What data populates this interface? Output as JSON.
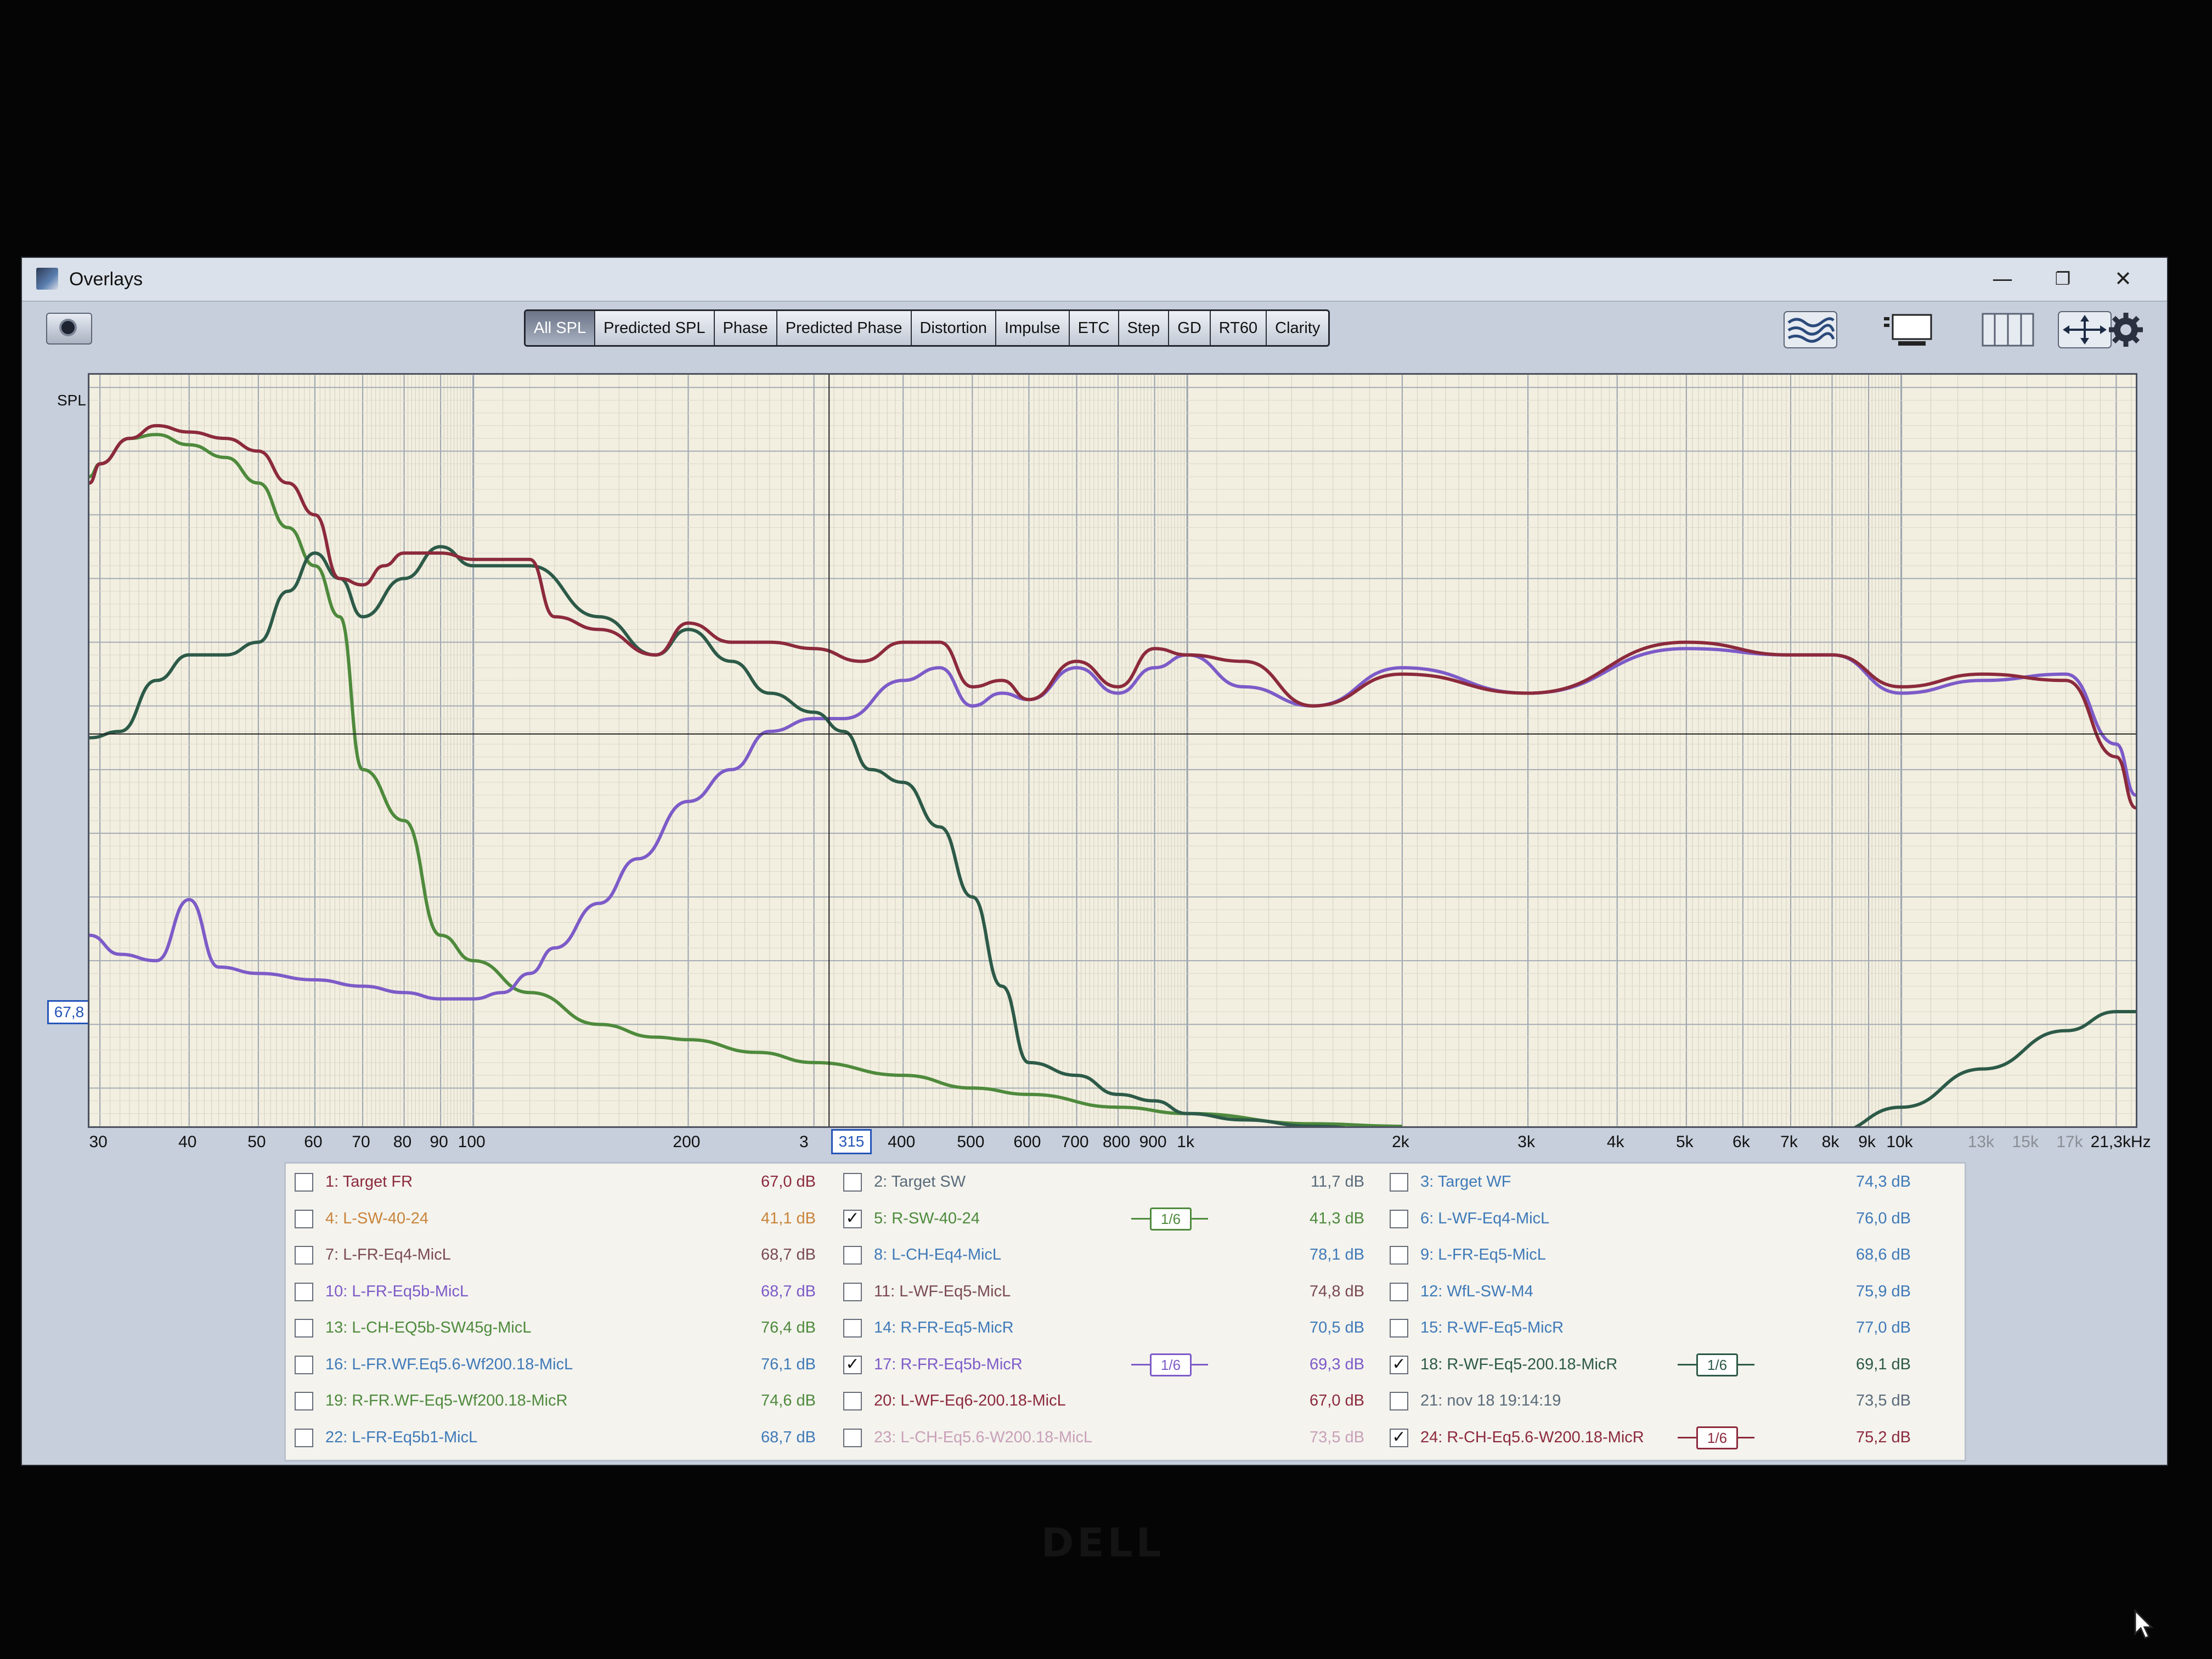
{
  "window": {
    "title": "Overlays"
  },
  "window_controls": {
    "minimize": "—",
    "restore": "❐",
    "close": "✕"
  },
  "toolbar": {
    "tabs": [
      "All SPL",
      "Predicted SPL",
      "Phase",
      "Predicted Phase",
      "Distortion",
      "Impulse",
      "ETC",
      "Step",
      "GD",
      "RT60",
      "Clarity"
    ],
    "active_tab": "All SPL",
    "icons": [
      "camera-icon",
      "waveforms-icon",
      "layout-icon",
      "columns-icon",
      "fit-arrows-icon",
      "gear-icon"
    ]
  },
  "chart_data": {
    "type": "line",
    "ylabel": "SPL",
    "xscale": "log",
    "xlim": [
      29,
      21300
    ],
    "ylim": [
      37,
      96
    ],
    "y_ticks": [
      "95",
      "90",
      "85",
      "80",
      "75",
      "70",
      "65",
      "60",
      "55",
      "50",
      "45",
      "40"
    ],
    "x_ticks": [
      "30",
      "40",
      "50",
      "60",
      "70",
      "80",
      "90",
      "100",
      "200",
      "3",
      "400",
      "500",
      "600",
      "700",
      "800",
      "900",
      "1k",
      "2k",
      "3k",
      "4k",
      "5k",
      "6k",
      "7k",
      "8k",
      "9k",
      "10k",
      "13k",
      "15k",
      "17k",
      "21,3kHz"
    ],
    "y_cursor": "67,8",
    "x_cursor": "315",
    "series": [
      {
        "name": "5: R-SW-40-24",
        "color": "#4e8a3c",
        "x": [
          29,
          30,
          33,
          36,
          40,
          45,
          50,
          55,
          60,
          65,
          70,
          80,
          90,
          100,
          120,
          150,
          180,
          200,
          250,
          300,
          400,
          500,
          600,
          800,
          1000,
          1500,
          2000
        ],
        "y": [
          88,
          89,
          91,
          91.3,
          90.5,
          89.5,
          87.5,
          84,
          81,
          77,
          65,
          61,
          52,
          50,
          47.5,
          45,
          44,
          43.8,
          42.8,
          42,
          41,
          40,
          39.5,
          38.5,
          38,
          37.2,
          37
        ]
      },
      {
        "name": "17: R-FR-Eq5b-MicR",
        "color": "#7d5bc8",
        "x": [
          29,
          32,
          36,
          40,
          44,
          50,
          60,
          70,
          80,
          90,
          100,
          110,
          120,
          130,
          150,
          170,
          200,
          230,
          260,
          300,
          330,
          400,
          450,
          500,
          550,
          600,
          700,
          800,
          900,
          1000,
          1200,
          1500,
          2000,
          3000,
          5000,
          7000,
          8000,
          10000,
          13000,
          17000,
          20000,
          21300
        ],
        "y": [
          52,
          50.5,
          50,
          54.8,
          49.5,
          49,
          48.5,
          48,
          47.5,
          47,
          47,
          47.5,
          49,
          51,
          54.5,
          58,
          62.5,
          65,
          68,
          69,
          69,
          72,
          73,
          70,
          71,
          70.5,
          73,
          71,
          73,
          74,
          71.5,
          70,
          73,
          71,
          74.5,
          74,
          74,
          71,
          72,
          72.5,
          67,
          63
        ]
      },
      {
        "name": "18: R-WF-Eq5-200.18-MicR",
        "color": "#2d5a48",
        "x": [
          29,
          32,
          36,
          40,
          45,
          50,
          55,
          60,
          65,
          70,
          80,
          90,
          100,
          120,
          150,
          180,
          200,
          230,
          260,
          300,
          330,
          360,
          400,
          450,
          500,
          550,
          600,
          700,
          800,
          900,
          1000,
          1200,
          1500,
          2000,
          3000,
          5000,
          7000,
          8000,
          10000,
          13000,
          17000,
          20000,
          21300
        ],
        "y": [
          67.5,
          68,
          72,
          74,
          74,
          75,
          79,
          82,
          80,
          77,
          80,
          82.5,
          81,
          81,
          77,
          74,
          76,
          73.5,
          71,
          69.5,
          68,
          65,
          64,
          60.5,
          55,
          48,
          42,
          41,
          39.5,
          39,
          38,
          37.5,
          37,
          36.5,
          36,
          36,
          36,
          36.5,
          38.5,
          41.5,
          44.5,
          46,
          46
        ]
      },
      {
        "name": "24: R-CH-Eq5.6-W200.18-MicR",
        "color": "#8c2a3c",
        "x": [
          29,
          30,
          33,
          36,
          40,
          45,
          50,
          55,
          60,
          65,
          70,
          75,
          80,
          90,
          100,
          120,
          130,
          150,
          180,
          200,
          230,
          260,
          300,
          350,
          400,
          450,
          500,
          550,
          600,
          700,
          800,
          900,
          1000,
          1200,
          1500,
          2000,
          3000,
          5000,
          7000,
          8000,
          10000,
          13000,
          17000,
          20000,
          21300
        ],
        "y": [
          87.5,
          89,
          91,
          92,
          91.5,
          91,
          90,
          87.5,
          85,
          80,
          79.5,
          81,
          82,
          82,
          81.5,
          81.5,
          77,
          76,
          74,
          76.5,
          75,
          75,
          74.5,
          73.5,
          75,
          75,
          71.5,
          72,
          70.5,
          73.5,
          71.5,
          74.5,
          74,
          73.5,
          70,
          72.5,
          71,
          75,
          74,
          74,
          71.5,
          72.5,
          72,
          66,
          62
        ]
      }
    ]
  },
  "legend": {
    "columns": [
      [
        {
          "label": "1: Target FR",
          "value": "67,0 dB",
          "checked": false,
          "color": "#8c2a3c"
        },
        {
          "label": "4: L-SW-40-24",
          "value": "41,1 dB",
          "checked": false,
          "color": "#c9843a"
        },
        {
          "label": "7: L-FR-Eq4-MicL",
          "value": "68,7 dB",
          "checked": false,
          "color": "#7a4a52"
        },
        {
          "label": "10: L-FR-Eq5b-MicL",
          "value": "68,7 dB",
          "checked": false,
          "color": "#7d5bc8"
        },
        {
          "label": "13: L-CH-EQ5b-SW45g-MicL",
          "value": "76,4 dB",
          "checked": false,
          "color": "#4e8a3c"
        },
        {
          "label": "16: L-FR.WF.Eq5.6-Wf200.18-MicL",
          "value": "76,1 dB",
          "checked": false,
          "color": "#3f7ab8"
        },
        {
          "label": "19: R-FR.WF-Eq5-Wf200.18-MicR",
          "value": "74,6 dB",
          "checked": false,
          "color": "#4e8a3c"
        },
        {
          "label": "22: L-FR-Eq5b1-MicL",
          "value": "68,7 dB",
          "checked": false,
          "color": "#3f7ab8"
        }
      ],
      [
        {
          "label": "2: Target SW",
          "value": "11,7 dB",
          "checked": false,
          "color": "#5a6b7a"
        },
        {
          "label": "5: R-SW-40-24",
          "value": "41,3 dB",
          "checked": true,
          "color": "#4e8a3c",
          "smoothing": "1/6"
        },
        {
          "label": "8: L-CH-Eq4-MicL",
          "value": "78,1 dB",
          "checked": false,
          "color": "#3f7ab8"
        },
        {
          "label": "11: L-WF-Eq5-MicL",
          "value": "74,8 dB",
          "checked": false,
          "color": "#7a4a52"
        },
        {
          "label": "14: R-FR-Eq5-MicR",
          "value": "70,5 dB",
          "checked": false,
          "color": "#3f7ab8"
        },
        {
          "label": "17: R-FR-Eq5b-MicR",
          "value": "69,3 dB",
          "checked": true,
          "color": "#7d5bc8",
          "smoothing": "1/6"
        },
        {
          "label": "20: L-WF-Eq6-200.18-MicL",
          "value": "67,0 dB",
          "checked": false,
          "color": "#8c2a3c"
        },
        {
          "label": "23: L-CH-Eq5.6-W200.18-MicL",
          "value": "73,5 dB",
          "checked": false,
          "color": "#c9a0b8"
        }
      ],
      [
        {
          "label": "3: Target WF",
          "value": "74,3 dB",
          "checked": false,
          "color": "#3f7ab8"
        },
        {
          "label": "6: L-WF-Eq4-MicL",
          "value": "76,0 dB",
          "checked": false,
          "color": "#3f7ab8"
        },
        {
          "label": "9: L-FR-Eq5-MicL",
          "value": "68,6 dB",
          "checked": false,
          "color": "#3f7ab8"
        },
        {
          "label": "12: WfL-SW-M4",
          "value": "75,9 dB",
          "checked": false,
          "color": "#3f7ab8"
        },
        {
          "label": "15: R-WF-Eq5-MicR",
          "value": "77,0 dB",
          "checked": false,
          "color": "#3f7ab8"
        },
        {
          "label": "18: R-WF-Eq5-200.18-MicR",
          "value": "69,1 dB",
          "checked": true,
          "color": "#2d5a48",
          "smoothing": "1/6"
        },
        {
          "label": "21: nov 18 19:14:19",
          "value": "73,5 dB",
          "checked": false,
          "color": "#5a6b7a"
        },
        {
          "label": "24: R-CH-Eq5.6-W200.18-MicR",
          "value": "75,2 dB",
          "checked": true,
          "color": "#8c2a3c",
          "smoothing": "1/6"
        }
      ]
    ]
  }
}
